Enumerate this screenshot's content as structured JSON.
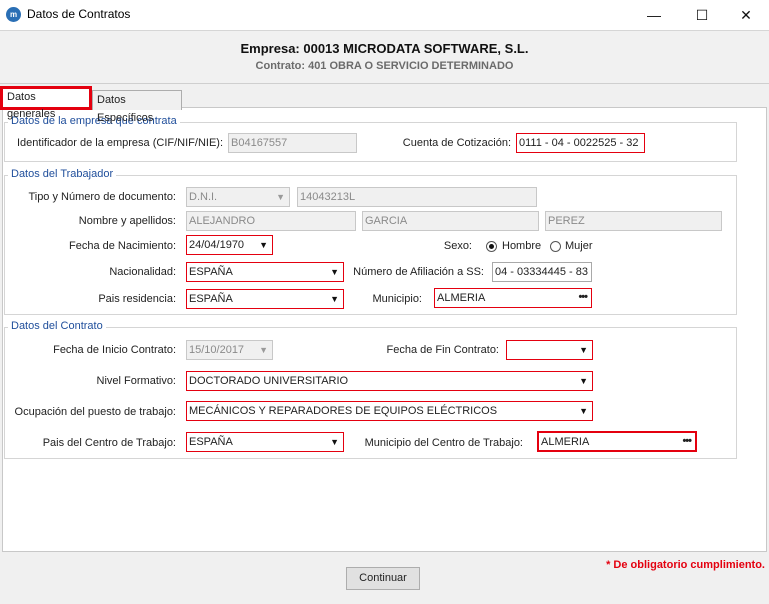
{
  "window": {
    "title": "Datos de Contratos",
    "app_icon_text": "m"
  },
  "header": {
    "company": "Empresa: 00013 MICRODATA SOFTWARE, S.L.",
    "contract": "Contrato: 401 OBRA O SERVICIO DETERMINADO"
  },
  "tabs": [
    {
      "label": "Datos generales",
      "active": true
    },
    {
      "label": "Datos Específicos",
      "active": false
    }
  ],
  "empresa": {
    "title": "Datos de la empresa que contrata",
    "id_label": "Identificador de la empresa (CIF/NIF/NIE):",
    "id_value": "B04167557",
    "cuenta_label": "Cuenta de Cotización:",
    "cuenta_value": "0111 - 04 - 0022525 - 32"
  },
  "trabajador": {
    "title": "Datos del Trabajador",
    "doc_label": "Tipo y Número de documento:",
    "doc_type": "D.N.I.",
    "doc_number": "14043213L",
    "name_label": "Nombre y apellidos:",
    "first_name": "ALEJANDRO",
    "surname1": "GARCIA",
    "surname2": "PEREZ",
    "birth_label": "Fecha de Nacimiento:",
    "birth_value": "24/04/1970",
    "sex_label": "Sexo:",
    "sex_options": [
      "Hombre",
      "Mujer"
    ],
    "sex_selected": "Hombre",
    "nationality_label": "Nacionalidad:",
    "nationality_value": "ESPAÑA",
    "ss_label": "Número de Afiliación a SS:",
    "ss_value": "04 - 03334445 - 83",
    "country_label": "Pais residencia:",
    "country_value": "ESPAÑA",
    "municipality_label": "Municipio:",
    "municipality_value": "ALMERIA"
  },
  "contrato": {
    "title": "Datos del Contrato",
    "start_label": "Fecha de Inicio Contrato:",
    "start_value": "15/10/2017",
    "end_label": "Fecha de Fin Contrato:",
    "end_value": "",
    "level_label": "Nivel Formativo:",
    "level_value": "DOCTORADO UNIVERSITARIO",
    "job_label": "Ocupación del puesto de trabajo:",
    "job_value": "MECÁNICOS Y REPARADORES DE EQUIPOS ELÉCTRICOS",
    "work_country_label": "Pais del Centro de Trabajo:",
    "work_country_value": "ESPAÑA",
    "work_municipality_label": "Municipio del Centro de Trabajo:",
    "work_municipality_value": "ALMERIA"
  },
  "footer": {
    "note": "* De obligatorio cumplimiento.",
    "continue_label": "Continuar"
  },
  "colors": {
    "required_border": "#e4000f",
    "group_title": "#1f4e9b",
    "footer_note": "#e4000f"
  }
}
